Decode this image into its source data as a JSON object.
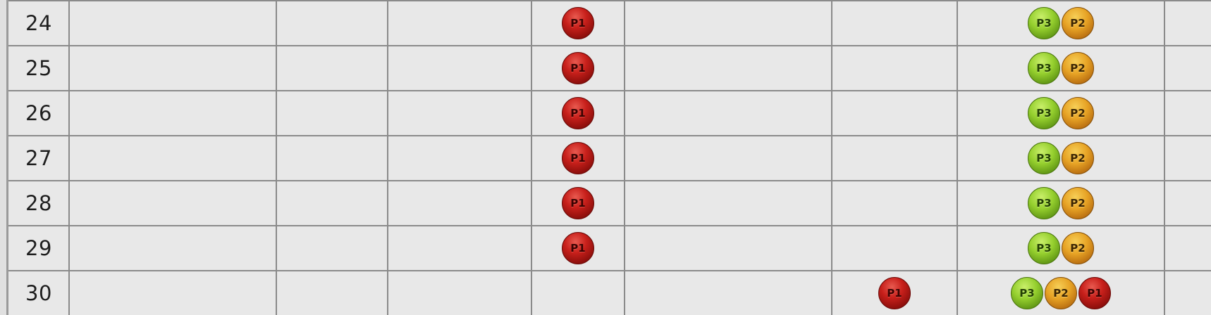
{
  "grid": {
    "rows": [
      {
        "label": "24",
        "cells": [
          {
            "col": 4,
            "tokens": [
              "P1"
            ]
          },
          {
            "col": 7,
            "tokens": [
              "P3",
              "P2"
            ]
          }
        ]
      },
      {
        "label": "25",
        "cells": [
          {
            "col": 4,
            "tokens": [
              "P1"
            ]
          },
          {
            "col": 7,
            "tokens": [
              "P3",
              "P2"
            ]
          }
        ]
      },
      {
        "label": "26",
        "cells": [
          {
            "col": 4,
            "tokens": [
              "P1"
            ]
          },
          {
            "col": 7,
            "tokens": [
              "P3",
              "P2"
            ]
          }
        ]
      },
      {
        "label": "27",
        "cells": [
          {
            "col": 4,
            "tokens": [
              "P1"
            ]
          },
          {
            "col": 7,
            "tokens": [
              "P3",
              "P2"
            ]
          }
        ]
      },
      {
        "label": "28",
        "cells": [
          {
            "col": 4,
            "tokens": [
              "P1"
            ]
          },
          {
            "col": 7,
            "tokens": [
              "P3",
              "P2"
            ]
          }
        ]
      },
      {
        "label": "29",
        "cells": [
          {
            "col": 4,
            "tokens": [
              "P1"
            ]
          },
          {
            "col": 7,
            "tokens": [
              "P3",
              "P2"
            ]
          }
        ]
      },
      {
        "label": "30",
        "cells": [
          {
            "col": 6,
            "tokens": [
              "P1"
            ]
          },
          {
            "col": 7,
            "tokens": [
              "P3",
              "P2",
              "P1"
            ]
          }
        ]
      }
    ]
  },
  "token_colors": {
    "P1": "#c8201b",
    "P2": "#e7a325",
    "P3": "#95cf2e"
  }
}
